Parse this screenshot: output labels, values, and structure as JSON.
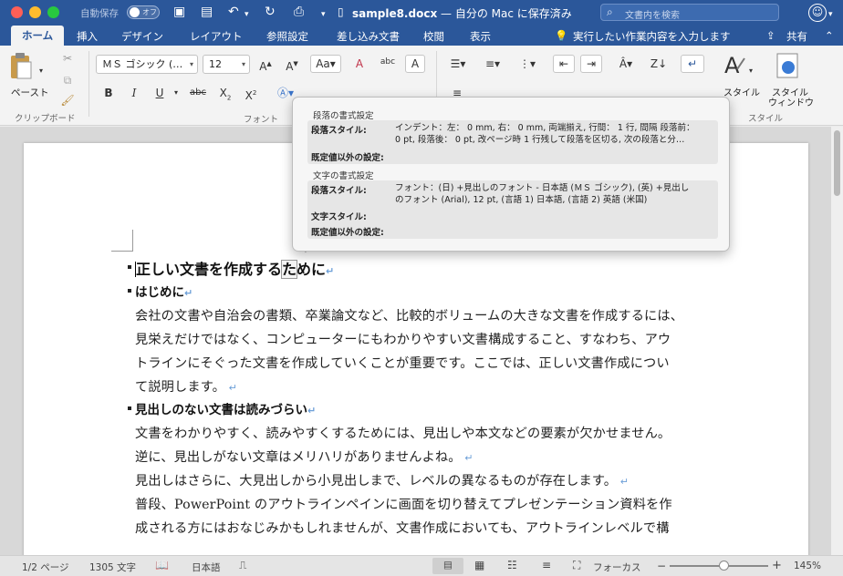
{
  "titlebar": {
    "autosave_label": "自動保存",
    "autosave_state": "オフ",
    "doc_name": "sample8.docx",
    "doc_location": " — 自分の Mac に保存済み",
    "search_placeholder": "文書内を検索"
  },
  "tabs": [
    "ホーム",
    "挿入",
    "デザイン",
    "レイアウト",
    "参照設定",
    "差し込み文書",
    "校閲",
    "表示"
  ],
  "tell_me": "実行したい作業内容を入力します",
  "share": "共有",
  "ribbon": {
    "paste_label": "ペースト",
    "font_name": "ＭＳ ゴシック (…",
    "font_size": "12",
    "clipboard_group": "クリップボード",
    "font_group": "フォント",
    "style_group": "スタイル",
    "styles_label": "スタイル",
    "style_window_label_1": "スタイル",
    "style_window_label_2": "ウィンドウ"
  },
  "tooltip": {
    "para_format_title": "段落の書式設定",
    "para_style_label": "段落スタイル:",
    "para_style_value_1": "インデント：左： 0 mm, 右： 0 mm, 両端揃え, 行間： 1 行, 間隔 段落前：",
    "para_style_value_2": "0 pt, 段落後： 0 pt, 改ページ時 1 行残して段落を区切る, 次の段落と分…",
    "non_default_label": "既定値以外の設定:",
    "char_format_title": "文字の書式設定",
    "char_para_style_label": "段落スタイル:",
    "char_para_style_value_1": "フォント：(日) +見出しのフォント - 日本語 (ＭＳ ゴシック), (英) +見出し",
    "char_para_style_value_2": "のフォント (Arial), 12 pt, (言語 1) 日本語, (言語 2) 英語 (米国)",
    "char_style_label": "文字スタイル:",
    "char_non_default_label": "既定値以外の設定:"
  },
  "document": {
    "title_pre": "正しい文書を作成する",
    "title_hl": "た",
    "title_post": "めに",
    "h1": "はじめに",
    "p1": [
      "会社の文書や自治会の書類、卒業論文など、比較的ボリュームの大きな文書を作成するには、",
      "見栄えだけではなく、コンピューターにもわかりやすい文書構成すること、すなわち、アウ",
      "トラインにそぐった文書を作成していくことが重要です。ここでは、正しい文書作成につい",
      "て説明します。"
    ],
    "h2": "見出しのない文書は読みづらい",
    "p2": [
      "文書をわかりやすく、読みやすくするためには、見出しや本文などの要素が欠かせません。",
      "逆に、見出しがない文章はメリハリがありませんよね。",
      "見出しはさらに、大見出しから小見出しまで、レベルの異なるものが存在します。",
      "普段、PowerPoint のアウトラインペインに画面を切り替えてプレゼンテーション資料を作",
      "成される方にはおなじみかもしれませんが、文書作成においても、アウトラインレベルで構"
    ]
  },
  "status": {
    "page": "1/2 ページ",
    "words": "1305 文字",
    "language": "日本語",
    "focus": "フォーカス",
    "zoom_minus": "−",
    "zoom_plus": "+",
    "zoom": "145%"
  }
}
